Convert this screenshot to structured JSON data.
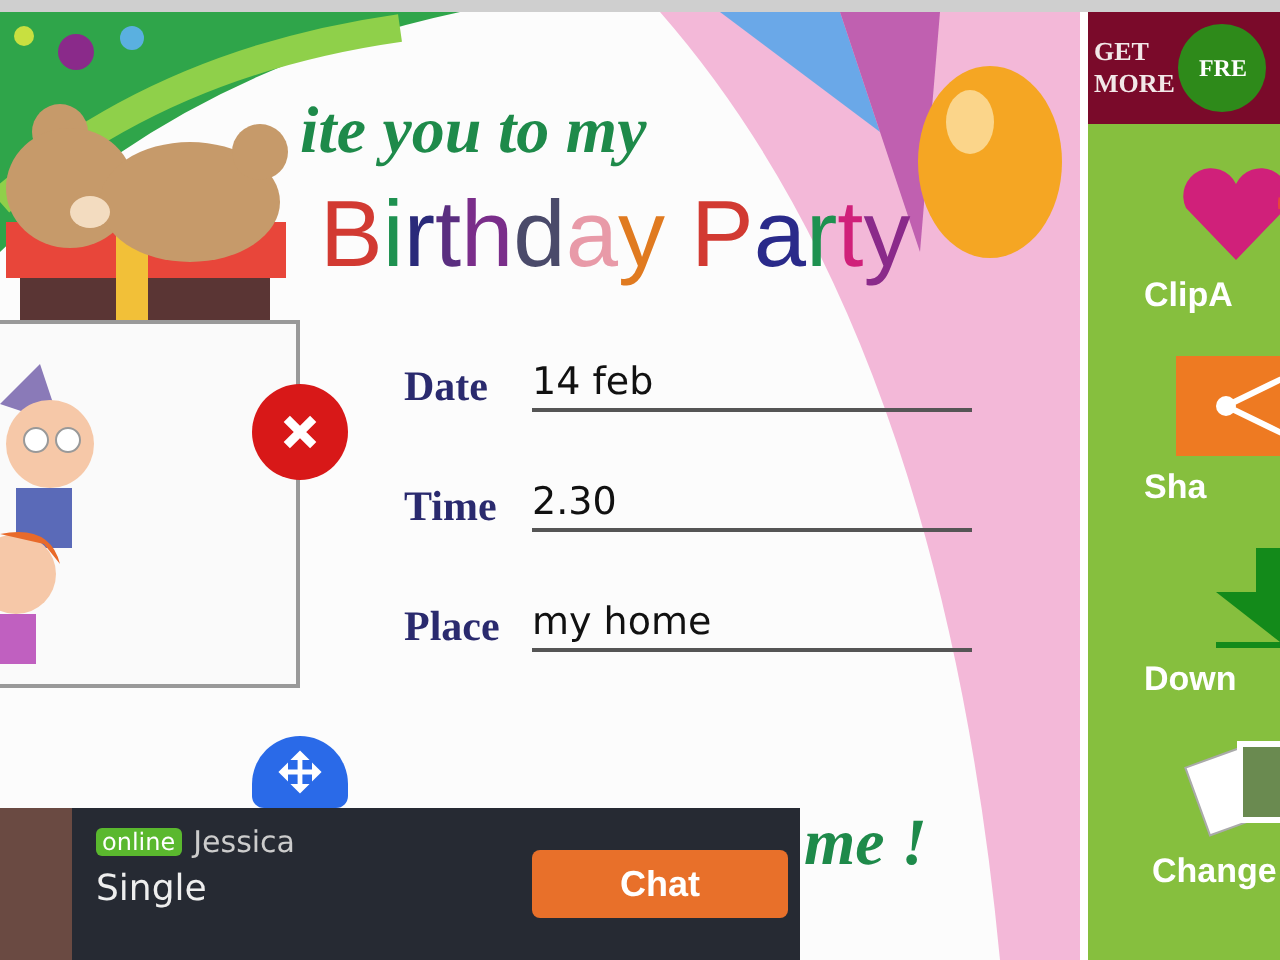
{
  "card": {
    "greeting": "ite you to my",
    "title": "Birthday Party",
    "fields": [
      {
        "label": "Date",
        "value": "14 feb"
      },
      {
        "label": "Time",
        "value": "2.30"
      },
      {
        "label": "Place",
        "value": "my home"
      }
    ],
    "closing": "me !"
  },
  "sidebar": {
    "promo": {
      "line1": "GET",
      "line2": "MORE",
      "badge": "FRE"
    },
    "items": [
      {
        "kind": "clipart",
        "label": "ClipA"
      },
      {
        "kind": "share",
        "label": "Sha"
      },
      {
        "kind": "download",
        "label": "Down"
      },
      {
        "kind": "change",
        "label": "Change"
      }
    ]
  },
  "ad": {
    "status": "online",
    "name": "Jessica",
    "tagline": "Single",
    "button": "Chat"
  }
}
